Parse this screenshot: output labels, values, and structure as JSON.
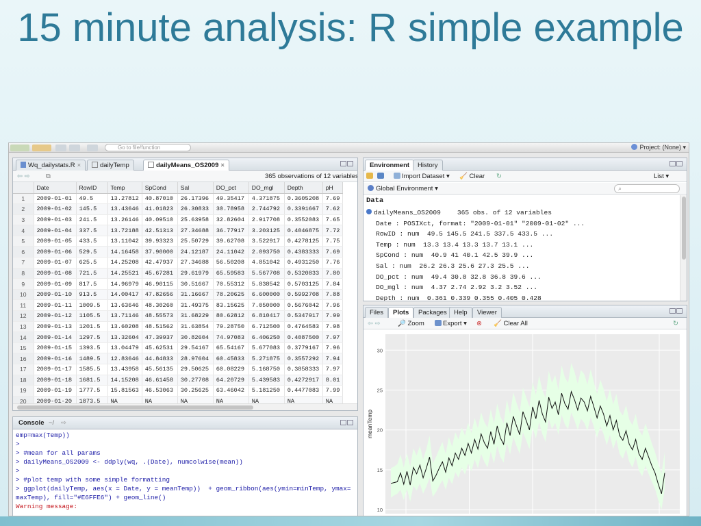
{
  "slide": {
    "title": "15 minute analysis: R simple example"
  },
  "topbar": {
    "goto_placeholder": "Go to file/function",
    "project_label": "Project: (None) ▾"
  },
  "source": {
    "tabs": [
      {
        "label": "Wq_dailystats.R",
        "close": "×"
      },
      {
        "label": "dailyTemp",
        "close": "×"
      },
      {
        "label": "dailyMeans_OS2009",
        "close": "×"
      }
    ],
    "obs_text": "365 observations of 12 variables",
    "columns": [
      "",
      "Date",
      "RowID",
      "Temp",
      "SpCond",
      "Sal",
      "DO_pct",
      "DO_mgl",
      "Depth",
      "pH"
    ],
    "rows": [
      [
        "1",
        "2009-01-01",
        "49.5",
        "13.27812",
        "40.87010",
        "26.17396",
        "49.35417",
        "4.371875",
        "0.3605208",
        "7.69"
      ],
      [
        "2",
        "2009-01-02",
        "145.5",
        "13.43646",
        "41.01823",
        "26.30833",
        "30.78958",
        "2.744792",
        "0.3391667",
        "7.62"
      ],
      [
        "3",
        "2009-01-03",
        "241.5",
        "13.26146",
        "40.09510",
        "25.63958",
        "32.82604",
        "2.917708",
        "0.3552083",
        "7.65"
      ],
      [
        "4",
        "2009-01-04",
        "337.5",
        "13.72188",
        "42.51313",
        "27.34688",
        "36.77917",
        "3.203125",
        "0.4046875",
        "7.72"
      ],
      [
        "5",
        "2009-01-05",
        "433.5",
        "13.11042",
        "39.93323",
        "25.50729",
        "39.62708",
        "3.522917",
        "0.4278125",
        "7.75"
      ],
      [
        "6",
        "2009-01-06",
        "529.5",
        "14.16458",
        "37.90000",
        "24.12187",
        "24.11042",
        "2.093750",
        "0.4383333",
        "7.69"
      ],
      [
        "7",
        "2009-01-07",
        "625.5",
        "14.25208",
        "42.47937",
        "27.34688",
        "56.50208",
        "4.851042",
        "0.4931250",
        "7.76"
      ],
      [
        "8",
        "2009-01-08",
        "721.5",
        "14.25521",
        "45.67281",
        "29.61979",
        "65.59583",
        "5.567708",
        "0.5320833",
        "7.80"
      ],
      [
        "9",
        "2009-01-09",
        "817.5",
        "14.96979",
        "46.90115",
        "30.51667",
        "70.55312",
        "5.838542",
        "0.5703125",
        "7.84"
      ],
      [
        "10",
        "2009-01-10",
        "913.5",
        "14.00417",
        "47.82656",
        "31.16667",
        "78.20625",
        "6.600000",
        "0.5992708",
        "7.88"
      ],
      [
        "11",
        "2009-01-11",
        "1009.5",
        "13.63646",
        "48.30260",
        "31.49375",
        "83.15625",
        "7.050000",
        "0.5676042",
        "7.96"
      ],
      [
        "12",
        "2009-01-12",
        "1105.5",
        "13.71146",
        "48.55573",
        "31.68229",
        "80.62812",
        "6.810417",
        "0.5347917",
        "7.99"
      ],
      [
        "13",
        "2009-01-13",
        "1201.5",
        "13.60208",
        "48.51562",
        "31.63854",
        "79.28750",
        "6.712500",
        "0.4764583",
        "7.98"
      ],
      [
        "14",
        "2009-01-14",
        "1297.5",
        "13.32604",
        "47.39937",
        "30.82604",
        "74.97083",
        "6.406250",
        "0.4087500",
        "7.97"
      ],
      [
        "15",
        "2009-01-15",
        "1393.5",
        "13.04479",
        "45.62531",
        "29.54167",
        "65.54167",
        "5.677083",
        "0.3779167",
        "7.96"
      ],
      [
        "16",
        "2009-01-16",
        "1489.5",
        "12.83646",
        "44.84833",
        "28.97604",
        "60.45833",
        "5.271875",
        "0.3557292",
        "7.94"
      ],
      [
        "17",
        "2009-01-17",
        "1585.5",
        "13.43958",
        "45.56135",
        "29.50625",
        "60.08229",
        "5.168750",
        "0.3858333",
        "7.97"
      ],
      [
        "18",
        "2009-01-18",
        "1681.5",
        "14.15208",
        "46.61458",
        "30.27708",
        "64.20729",
        "5.439583",
        "0.4272917",
        "8.01"
      ],
      [
        "19",
        "2009-01-19",
        "1777.5",
        "15.81563",
        "46.53063",
        "30.25625",
        "63.46042",
        "5.181250",
        "0.4477083",
        "7.99"
      ],
      [
        "20",
        "2009-01-20",
        "1873.5",
        "NA",
        "NA",
        "NA",
        "NA",
        "NA",
        "NA",
        "NA"
      ]
    ]
  },
  "console": {
    "title": "Console",
    "path": "~/",
    "lines": [
      {
        "text": "emp=max(Temp))",
        "warn": false
      },
      {
        "text": ">",
        "warn": false
      },
      {
        "text": "> #mean for all params",
        "warn": false
      },
      {
        "text": "> dailyMeans_OS2009 <- ddply(wq, .(Date), numcolwise(mean))",
        "warn": false
      },
      {
        "text": ">",
        "warn": false
      },
      {
        "text": "> #plot temp with some simple formatting",
        "warn": false
      },
      {
        "text": "> ggplot(dailyTemp, aes(x = Date, y = meanTemp))  + geom_ribbon(aes(ymin=minTemp, ymax=",
        "warn": false
      },
      {
        "text": "maxTemp), fill=\"#E6FFE6\") + geom_line()",
        "warn": false
      },
      {
        "text": "Warning message:",
        "warn": true
      }
    ]
  },
  "environment": {
    "tabs": [
      "Environment",
      "History"
    ],
    "toolbar": {
      "import": "Import Dataset ▾",
      "clear": "Clear",
      "list": "List ▾"
    },
    "scope": "Global Environment ▾",
    "section": "Data",
    "object_name": "dailyMeans_OS2009",
    "object_desc": "365 obs. of 12 variables",
    "vars": [
      "Date : POSIXct, format: \"2009-01-01\" \"2009-01-02\" ...",
      "RowID : num  49.5 145.5 241.5 337.5 433.5 ...",
      "Temp : num  13.3 13.4 13.3 13.7 13.1 ...",
      "SpCond : num  40.9 41 40.1 42.5 39.9 ...",
      "Sal : num  26.2 26.3 25.6 27.3 25.5 ...",
      "DO_pct : num  49.4 30.8 32.8 36.8 39.6 ...",
      "DO_mgl : num  4.37 2.74 2.92 3.2 3.52 ...",
      "Depth : num  0.361 0.339 0.355 0.405 0.428"
    ]
  },
  "files": {
    "tabs": [
      "Files",
      "Plots",
      "Packages",
      "Help",
      "Viewer"
    ],
    "toolbar": {
      "zoom": "Zoom",
      "export": "Export ▾",
      "clear_all": "Clear All"
    }
  },
  "colors": {
    "ribbon": "#E6FFE6",
    "panel": "#EBEBEB",
    "line": "#111111",
    "title": "#2E7A98"
  },
  "chart_data": {
    "type": "line",
    "ylabel": "meanTemp",
    "ylim": [
      9.5,
      32
    ],
    "yticks": [
      10,
      15,
      20,
      25,
      30
    ],
    "ribbon_fill": "#E6FFE6",
    "values": [
      13.3,
      13.4,
      13.5,
      14.6,
      13.2,
      14.8,
      13.1,
      15.3,
      14.5,
      15.6,
      14.0,
      15.2,
      16.6,
      13.6,
      14.3,
      15.2,
      16.0,
      14.7,
      16.5,
      15.5,
      17.1,
      16.3,
      17.7,
      16.8,
      18.3,
      17.1,
      18.8,
      17.6,
      19.5,
      18.4,
      17.7,
      19.8,
      18.2,
      20.5,
      19.0,
      18.2,
      20.9,
      19.3,
      21.7,
      20.5,
      19.4,
      22.3,
      21.2,
      20.0,
      22.9,
      21.4,
      23.7,
      22.0,
      21.0,
      24.1,
      22.7,
      23.5,
      21.9,
      24.6,
      23.3,
      22.6,
      24.8,
      23.8,
      22.5,
      24.0,
      23.5,
      22.4,
      24.2,
      22.9,
      21.5,
      23.0,
      22.0,
      20.5,
      21.8,
      20.0,
      21.2,
      19.3,
      18.7,
      19.9,
      18.2,
      17.5,
      18.8,
      17.0,
      16.3,
      17.7,
      16.6,
      15.5,
      14.6,
      13.2,
      12.0,
      14.6
    ],
    "ribbon_min": [
      11.5,
      11.8,
      12.0,
      12.5,
      11.2,
      12.6,
      11.0,
      13.0,
      12.4,
      13.3,
      12.0,
      12.9,
      14.0,
      11.6,
      12.2,
      13.0,
      13.7,
      12.5,
      14.0,
      13.2,
      14.7,
      14.0,
      15.3,
      14.4,
      15.8,
      14.8,
      16.3,
      15.2,
      17.0,
      16.0,
      15.3,
      17.3,
      15.8,
      18.0,
      16.6,
      15.9,
      18.4,
      16.9,
      19.1,
      18.0,
      17.0,
      19.7,
      18.7,
      17.6,
      20.3,
      18.9,
      21.0,
      19.5,
      18.5,
      21.4,
      20.1,
      20.9,
      19.4,
      21.9,
      20.7,
      20.1,
      22.2,
      21.2,
      20.0,
      21.4,
      20.9,
      19.9,
      21.6,
      20.4,
      19.0,
      20.5,
      19.5,
      18.1,
      19.4,
      17.6,
      18.8,
      17.0,
      16.4,
      17.6,
      16.0,
      15.3,
      16.6,
      14.9,
      14.2,
      15.5,
      14.5,
      13.5,
      12.6,
      11.2,
      10.0,
      12.6
    ],
    "ribbon_max": [
      15.2,
      15.4,
      15.7,
      16.9,
      15.3,
      17.1,
      15.4,
      17.7,
      16.8,
      18.0,
      16.3,
      17.6,
      19.3,
      15.8,
      16.6,
      17.6,
      18.5,
      17.0,
      19.1,
      17.9,
      19.7,
      18.8,
      20.3,
      19.3,
      20.9,
      19.6,
      21.5,
      20.2,
      22.2,
      21.0,
      20.3,
      22.6,
      20.8,
      23.3,
      21.7,
      20.8,
      23.8,
      22.0,
      24.7,
      23.4,
      22.2,
      25.3,
      24.1,
      22.9,
      26.0,
      24.4,
      26.8,
      25.0,
      24.0,
      27.4,
      25.9,
      26.9,
      25.0,
      28.1,
      26.6,
      25.9,
      28.4,
      27.3,
      25.8,
      27.5,
      27.0,
      25.7,
      27.6,
      26.0,
      24.5,
      26.3,
      25.2,
      23.6,
      25.1,
      23.2,
      24.5,
      22.4,
      21.8,
      23.1,
      21.3,
      20.6,
      22.0,
      20.0,
      19.3,
      20.8,
      19.6,
      18.3,
      17.2,
      15.8,
      14.5,
      17.2
    ]
  }
}
